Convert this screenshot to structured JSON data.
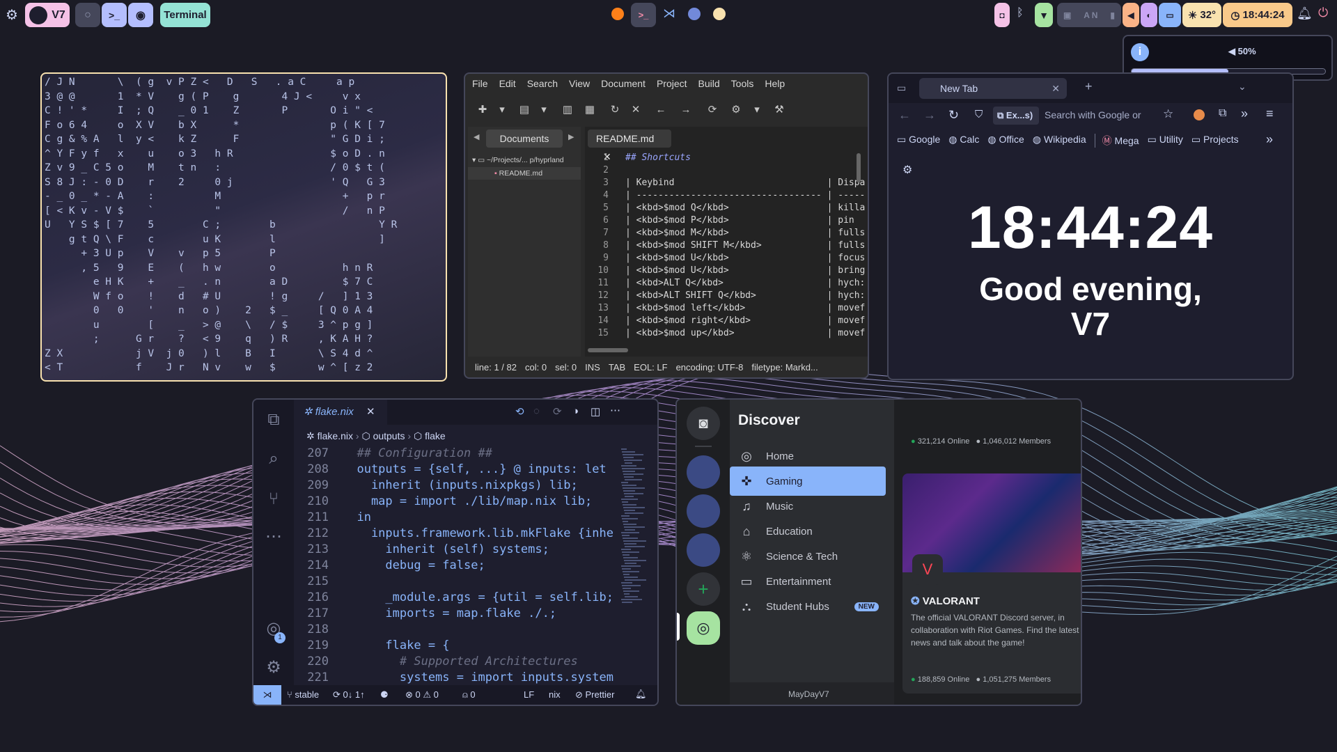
{
  "top_bar": {
    "workspace_label": "V7",
    "terminal_label": "Terminal",
    "terminal_icon": ">_",
    "weather": "32°",
    "clock": "18:44:24",
    "kbd_indicators": "A N"
  },
  "volume_osd": {
    "value_text": "50%",
    "level": 0.5
  },
  "matrix": {
    "rows": [
      "/ J N       \\  ( g  v P Z <   D   S   . a C     a p",
      "3 @ @       1  * V    g ( P    g       4 J <     v x",
      "C ! ' *     I  ; Q    _ 0 1    Z       P       O i \" <",
      "F o 6 4     o  X V    b X      *               p ( K [ 7",
      "C g & % A   l  y <    k Z      F               \" G D i ;",
      "^ Y F y f   x    u    o 3   h R                $ o D . n",
      "Z v 9 _ C 5 o    M    t n   :                  / 0 $ t (",
      "S 8 J : - 0 D    r    2     0 j                ' Q   G 3",
      "- _ 0 _ * - A    :          M                    +   p r",
      "[ < K v - V $    `          \"                    /   n P",
      "U   Y S $ [ 7    5        C ;        b                 Y R",
      "    g t Q \\ F    c        u K        l                 ]",
      "      + 3 U p    V    v   p 5        P",
      "      , 5   9    E    (   h w        o           h n R",
      "        e H K    +    _   . n        a D         $ 7 C",
      "        W f o    !    d   # U        ! g     /   ] 1 3",
      "        0   0    '    n   o )    2   $ _     [ Q 0 A 4",
      "        u        [    _   > @    \\   / $     3 ^ p g ]",
      "        ;      G r    ?   < 9    q   ) R     , K A H ?",
      "Z X            j V  j 0   ) l    B   I       \\ S 4 d ^",
      "< T            f    J r   N v    w   $       w ^ [ z 2"
    ]
  },
  "geany": {
    "menu": [
      "File",
      "Edit",
      "Search",
      "View",
      "Document",
      "Project",
      "Build",
      "Tools",
      "Help"
    ],
    "sidebar_tab": "Documents",
    "tree_folder": "~/Projects/... p/hyprland",
    "tree_file": "README.md",
    "doc_tab": "README.md",
    "lines": [
      {
        "n": "1",
        "t": "## Shortcuts"
      },
      {
        "n": "2",
        "t": ""
      },
      {
        "n": "3",
        "t": "| Keybind                            | Dispa"
      },
      {
        "n": "4",
        "t": "| ---------------------------------- | -----"
      },
      {
        "n": "5",
        "t": "| <kbd>$mod Q</kbd>                  | killa"
      },
      {
        "n": "6",
        "t": "| <kbd>$mod P</kbd>                  | pin"
      },
      {
        "n": "7",
        "t": "| <kbd>$mod M</kbd>                  | fulls"
      },
      {
        "n": "8",
        "t": "| <kbd>$mod SHIFT M</kbd>            | fulls"
      },
      {
        "n": "9",
        "t": "| <kbd>$mod U</kbd>                  | focus"
      },
      {
        "n": "10",
        "t": "| <kbd>$mod U</kbd>                  | bring"
      },
      {
        "n": "11",
        "t": "| <kbd>ALT Q</kbd>                   | hych:"
      },
      {
        "n": "12",
        "t": "| <kbd>ALT SHIFT Q</kbd>             | hych:"
      },
      {
        "n": "13",
        "t": "| <kbd>$mod left</kbd>               | movef"
      },
      {
        "n": "14",
        "t": "| <kbd>$mod right</kbd>              | movef"
      },
      {
        "n": "15",
        "t": "| <kbd>$mod up</kbd>                 | movef"
      }
    ],
    "status": [
      "line: 1 / 82",
      "col: 0",
      "sel: 0",
      "INS",
      "TAB",
      "EOL: LF",
      "encoding: UTF-8",
      "filetype: Markd..."
    ]
  },
  "browser": {
    "tab_title": "New Tab",
    "url_chip": "Ex...s)",
    "url_placeholder": "Search with Google or",
    "bookmarks": [
      "Google",
      "Calc",
      "Office",
      "Wikipedia",
      "Mega",
      "Utility",
      "Projects"
    ],
    "clock": "18:44:24",
    "greeting_line1": "Good evening,",
    "greeting_line2": "V7"
  },
  "vscode": {
    "tab": "flake.nix",
    "breadcrumb": [
      "flake.nix",
      "outputs",
      "flake"
    ],
    "account_badge": "1",
    "lines": [
      {
        "n": "207",
        "t": "  ## Configuration ##"
      },
      {
        "n": "208",
        "t": "  outputs = {self, ...} @ inputs: let"
      },
      {
        "n": "209",
        "t": "    inherit (inputs.nixpkgs) lib;"
      },
      {
        "n": "210",
        "t": "    map = import ./lib/map.nix lib;"
      },
      {
        "n": "211",
        "t": "  in"
      },
      {
        "n": "212",
        "t": "    inputs.framework.lib.mkFlake {inhe"
      },
      {
        "n": "213",
        "t": "      inherit (self) systems;"
      },
      {
        "n": "214",
        "t": "      debug = false;"
      },
      {
        "n": "215",
        "t": ""
      },
      {
        "n": "216",
        "t": "      _module.args = {util = self.lib;"
      },
      {
        "n": "217",
        "t": "      imports = map.flake ./.;"
      },
      {
        "n": "218",
        "t": ""
      },
      {
        "n": "219",
        "t": "      flake = {"
      },
      {
        "n": "220",
        "t": "        # Supported Architectures"
      },
      {
        "n": "221",
        "t": "        systems = import inputs.system"
      }
    ],
    "status": {
      "branch": "stable",
      "sync": "0↓ 1↑",
      "errors": "0",
      "warnings": "0",
      "ports": "0",
      "eol": "LF",
      "lang": "nix",
      "formatter": "Prettier"
    }
  },
  "discord": {
    "heading": "Discover",
    "nav": [
      {
        "label": "Home",
        "icon": "compass-icon"
      },
      {
        "label": "Gaming",
        "icon": "gamepad-icon",
        "active": true
      },
      {
        "label": "Music",
        "icon": "music-icon"
      },
      {
        "label": "Education",
        "icon": "graduation-cap-icon"
      },
      {
        "label": "Science & Tech",
        "icon": "atom-icon"
      },
      {
        "label": "Entertainment",
        "icon": "tv-icon"
      },
      {
        "label": "Student Hubs",
        "icon": "hub-icon",
        "badge": "NEW"
      }
    ],
    "card1": {
      "online": "321,214 Online",
      "members": "1,046,012 Members"
    },
    "card2": {
      "name": "VALORANT",
      "description": "The official VALORANT Discord server, in collaboration with Riot Games. Find the latest news and talk about the game!",
      "online": "188,859 Online",
      "members": "1,051,275 Members"
    },
    "user": "MayDayV7"
  },
  "colors": {
    "accent": "#89b4fa",
    "active_nav": "#89b4fa",
    "terminal_pill": "#94e2d5",
    "clock_pill": "#f9c98a"
  }
}
